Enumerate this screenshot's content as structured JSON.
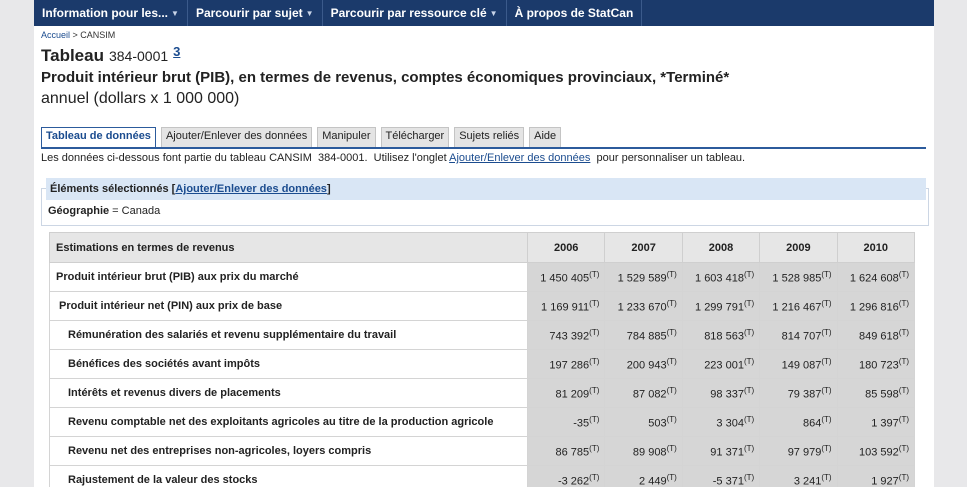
{
  "nav": {
    "items": [
      {
        "label": "Information pour les..."
      },
      {
        "label": "Parcourir par sujet"
      },
      {
        "label": "Parcourir par ressource clé"
      },
      {
        "label": "À propos de StatCan"
      }
    ]
  },
  "breadcrumb": {
    "home": "Accueil",
    "sep": " > ",
    "current": "CANSIM"
  },
  "title": {
    "label": "Tableau",
    "id": "384-0001",
    "footnote": "3"
  },
  "subtitle": "Produit intérieur brut (PIB), en termes de revenus, comptes économiques provinciaux, *Terminé*",
  "subtitle2": "annuel (dollars x 1 000 000)",
  "tabs": [
    "Tableau de données",
    "Ajouter/Enlever des données",
    "Manipuler",
    "Télécharger",
    "Sujets reliés",
    "Aide"
  ],
  "intro": {
    "before": "Les données ci-dessous font partie du tableau CANSIM  384-0001.  Utilisez l'onglet ",
    "link": "Ajouter/Enlever des données",
    "after": "  pour personnaliser un tableau."
  },
  "selection": {
    "heading": "Éléments sélectionnés [",
    "link": "Ajouter/Enlever des données",
    "close": "]",
    "geo_label": "Géographie",
    "geo_value": " = Canada"
  },
  "table": {
    "header": "Estimations en termes de revenus",
    "years": [
      "2006",
      "2007",
      "2008",
      "2009",
      "2010"
    ],
    "flag": "(T)",
    "rows": [
      {
        "label": "Produit intérieur brut (PIB) aux prix du marché",
        "values": [
          "1 450 405",
          "1 529 589",
          "1 603 418",
          "1 528 985",
          "1 624 608"
        ]
      },
      {
        "label": "Produit intérieur net (PIN) aux prix de base",
        "values": [
          "1 169 911",
          "1 233 670",
          "1 299 791",
          "1 216 467",
          "1 296 816"
        ]
      },
      {
        "label": "Rémunération des salariés et revenu supplémentaire du travail",
        "values": [
          "743 392",
          "784 885",
          "818 563",
          "814 707",
          "849 618"
        ]
      },
      {
        "label": "Bénéfices des sociétés avant impôts",
        "values": [
          "197 286",
          "200 943",
          "223 001",
          "149 087",
          "180 723"
        ]
      },
      {
        "label": "Intérêts et revenus divers de placements",
        "values": [
          "81 209",
          "87 082",
          "98 337",
          "79 387",
          "85 598"
        ]
      },
      {
        "label": "Revenu comptable net des exploitants agricoles au titre de la production agricole",
        "values": [
          "-35",
          "503",
          "3 304",
          "864",
          "1 397"
        ]
      },
      {
        "label": "Revenu net des entreprises non-agricoles, loyers compris",
        "values": [
          "86 785",
          "89 908",
          "91 371",
          "97 979",
          "103 592"
        ]
      },
      {
        "label": "Rajustement de la valeur des stocks",
        "values": [
          "-3 262",
          "2 449",
          "-5 371",
          "3 241",
          "1 927"
        ]
      }
    ]
  }
}
